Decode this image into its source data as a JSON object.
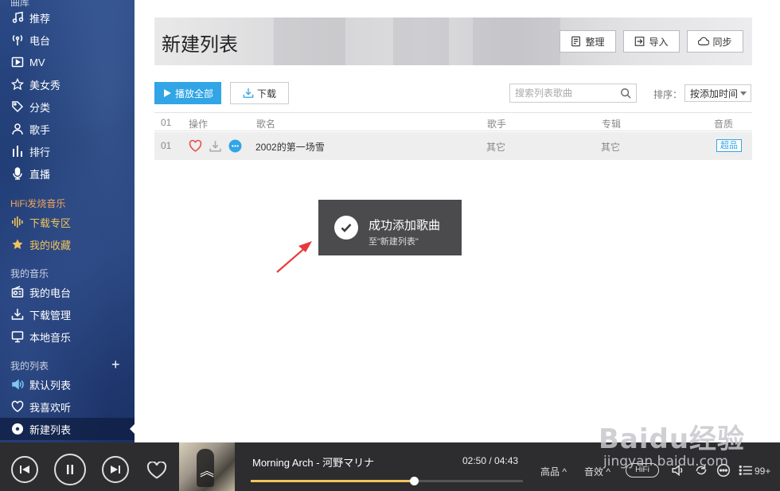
{
  "sidebar": {
    "top_section": "曲库",
    "items": [
      {
        "label": "推荐",
        "icon": "music-note-icon"
      },
      {
        "label": "电台",
        "icon": "radio-antenna-icon"
      },
      {
        "label": "MV",
        "icon": "mv-play-icon"
      },
      {
        "label": "美女秀",
        "icon": "star-outline-icon"
      },
      {
        "label": "分类",
        "icon": "tag-icon"
      },
      {
        "label": "歌手",
        "icon": "person-icon"
      },
      {
        "label": "排行",
        "icon": "bar-chart-icon"
      },
      {
        "label": "直播",
        "icon": "microphone-icon"
      }
    ],
    "hifi_heading": "HiFi发烧音乐",
    "hifi_items": [
      {
        "label": "下载专区",
        "icon": "sound-wave-icon"
      },
      {
        "label": "我的收藏",
        "icon": "star-filled-icon"
      }
    ],
    "my_music_heading": "我的音乐",
    "my_music_items": [
      {
        "label": "我的电台",
        "icon": "radio-box-icon"
      },
      {
        "label": "下载管理",
        "icon": "download-tray-icon"
      },
      {
        "label": "本地音乐",
        "icon": "monitor-icon"
      }
    ],
    "my_lists_heading": "我的列表",
    "add_list_symbol": "+",
    "list_items": [
      {
        "label": "默认列表",
        "icon": "speaker-icon"
      },
      {
        "label": "我喜欢听",
        "icon": "heart-outline-icon"
      },
      {
        "label": "新建列表",
        "icon": "disc-icon"
      }
    ]
  },
  "banner": {
    "title": "新建列表",
    "buttons": [
      {
        "label": "整理",
        "icon": "organize-icon"
      },
      {
        "label": "导入",
        "icon": "import-icon"
      },
      {
        "label": "同步",
        "icon": "cloud-sync-icon"
      }
    ]
  },
  "toolbar": {
    "play_all_label": "播放全部",
    "download_label": "下载",
    "search_placeholder": "搜索列表歌曲",
    "sort_label": "排序：",
    "sort_value": "按添加时间"
  },
  "table": {
    "headers": {
      "index": "01",
      "actions": "操作",
      "title": "歌名",
      "artist": "歌手",
      "album": "专辑",
      "quality": "音质"
    },
    "rows": [
      {
        "index": "01",
        "title": "2002的第一场雪",
        "artist": "其它",
        "album": "其它",
        "quality": "超品"
      }
    ]
  },
  "toast": {
    "title": "成功添加歌曲",
    "subtitle": "至\"新建列表\""
  },
  "watermark": {
    "brand": "Baidu经验",
    "url": "jingyan.baidu.com"
  },
  "player": {
    "track": "Morning Arch - 河野マリナ",
    "time": "02:50 / 04:43",
    "progress": 0.6,
    "quality": "高品",
    "effect": "音效",
    "hifi": "HiFi",
    "playlist_count": "99+",
    "accent": "#f2c45a"
  },
  "colors": {
    "primary": "#31a5e6",
    "sidebar_bg": "#233f7a",
    "player_bg": "#2d2d30"
  }
}
